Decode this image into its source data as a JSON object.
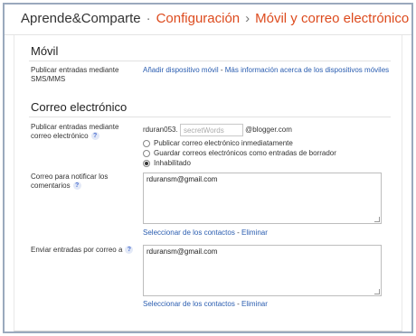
{
  "breadcrumb": {
    "blog_name": "Aprende&Comparte",
    "separator1": "·",
    "section": "Configuración",
    "separator2": "›",
    "current": "Móvil y correo electrónico"
  },
  "mobile": {
    "title": "Móvil",
    "sms_label": "Publicar entradas mediante SMS/MMS",
    "add_device_link": "Añadir dispositivo móvil",
    "link_separator": "-",
    "more_info_link": "Más información acerca de los dispositivos móviles"
  },
  "email": {
    "title": "Correo electrónico",
    "post_via_email_label": "Publicar entradas mediante correo electrónico",
    "address_prefix": "rduran053.",
    "secret_placeholder": "secretWords",
    "address_suffix": "@blogger.com",
    "options": [
      {
        "label": "Publicar correo electrónico inmediatamente",
        "selected": false
      },
      {
        "label": "Guardar correos electrónicos como entradas de borrador",
        "selected": false
      },
      {
        "label": "Inhabilitado",
        "selected": true
      }
    ],
    "comment_notify_label": "Correo para notificar los comentarios",
    "comment_notify_value": "rduransm@gmail.com",
    "comment_select_link": "Seleccionar de los contactos",
    "comment_link_sep": "-",
    "comment_remove_link": "Eliminar",
    "send_posts_label": "Enviar entradas por correo a",
    "send_posts_value": "rduransm@gmail.com",
    "send_select_link": "Seleccionar de los contactos",
    "send_link_sep": "-",
    "send_remove_link": "Eliminar"
  },
  "help_icon_char": "?"
}
